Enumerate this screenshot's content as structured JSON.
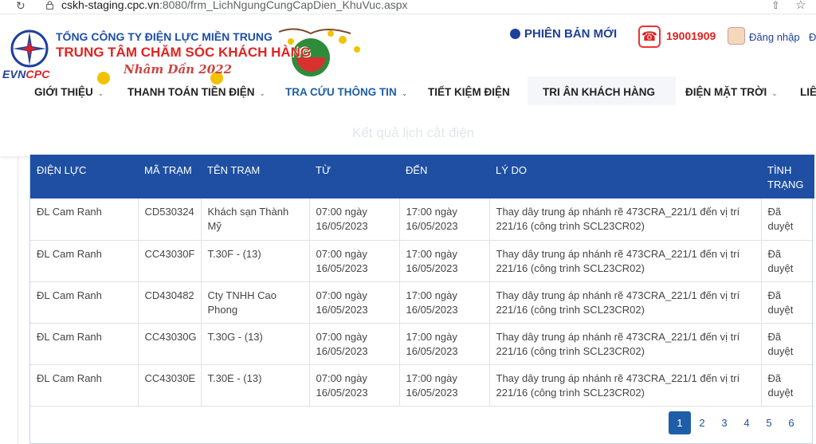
{
  "browser": {
    "url_host": "cskh-staging.cpc.vn",
    "url_rest": ":8080/frm_LichNgungCungCapDien_KhuVuc.aspx"
  },
  "header": {
    "logo_text_evn": "EVN",
    "logo_text_cpc": "CPC",
    "company": "TỔNG CÔNG TY ĐIỆN LỰC MIỀN TRUNG",
    "center": "TRUNG TÂM CHĂM SÓC KHÁCH HÀNG",
    "banner_year": "Nhâm Dần 2022",
    "new_version": "PHIÊN BẢN MỚI",
    "hotline": "19001909",
    "login": "Đăng nhập",
    "login_more": "Đ"
  },
  "nav": {
    "items": [
      {
        "label": "GIỚI THIỆU"
      },
      {
        "label": "THANH TOÁN TIỀN ĐIỆN"
      },
      {
        "label": "TRA CỨU THÔNG TIN"
      },
      {
        "label": "TIẾT KIỆM ĐIỆN"
      },
      {
        "label": "TRI ÂN KHÁCH HÀNG"
      },
      {
        "label": "ĐIỆN MẶT TRỜI"
      },
      {
        "label": "LIÊ"
      }
    ]
  },
  "faint_title": "Kết quả lịch cắt điện",
  "table": {
    "headers": [
      "ĐIỆN LỰC",
      "MÃ TRẠM",
      "TÊN TRẠM",
      "TỪ",
      "ĐẾN",
      "LÝ DO",
      "TÌNH TRẠNG"
    ],
    "rows": [
      [
        "ĐL Cam Ranh",
        "CD530324",
        "Khách sạn Thành Mỹ",
        "07:00 ngày 16/05/2023",
        "17:00 ngày 16/05/2023",
        "Thay dây trung áp nhánh rẽ 473CRA_221/1 đến vị trí 221/16 (công trình SCL23CR02)",
        "Đã duyệt"
      ],
      [
        "ĐL Cam Ranh",
        "CC43030F",
        "T.30F - (13)",
        "07:00 ngày 16/05/2023",
        "17:00 ngày 16/05/2023",
        "Thay dây trung áp nhánh rẽ 473CRA_221/1 đến vị trí 221/16 (công trình SCL23CR02)",
        "Đã duyệt"
      ],
      [
        "ĐL Cam Ranh",
        "CD430482",
        "Cty TNHH Cao Phong",
        "07:00 ngày 16/05/2023",
        "17:00 ngày 16/05/2023",
        "Thay dây trung áp nhánh rẽ 473CRA_221/1 đến vị trí 221/16 (công trình SCL23CR02)",
        "Đã duyệt"
      ],
      [
        "ĐL Cam Ranh",
        "CC43030G",
        "T.30G - (13)",
        "07:00 ngày 16/05/2023",
        "17:00 ngày 16/05/2023",
        "Thay dây trung áp nhánh rẽ 473CRA_221/1 đến vị trí 221/16 (công trình SCL23CR02)",
        "Đã duyệt"
      ],
      [
        "ĐL Cam Ranh",
        "CC43030E",
        "T.30E - (13)",
        "07:00 ngày 16/05/2023",
        "17:00 ngày 16/05/2023",
        "Thay dây trung áp nhánh rẽ 473CRA_221/1 đến vị trí 221/16 (công trình SCL23CR02)",
        "Đã duyệt"
      ]
    ]
  },
  "pagination": {
    "pages": [
      "1",
      "2",
      "3",
      "4",
      "5",
      "6"
    ],
    "current": "1"
  },
  "colors": {
    "header_blue": "#1e4fa3",
    "brand_red": "#e02020",
    "active_nav": "#1d5ea8"
  }
}
